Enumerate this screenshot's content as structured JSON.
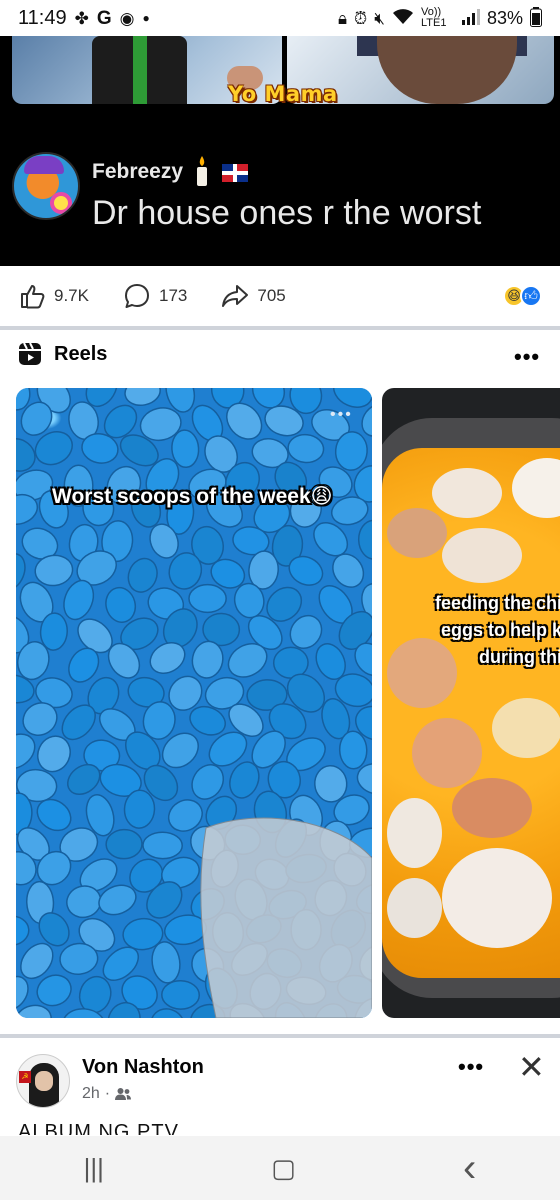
{
  "status_bar": {
    "time": "11:49",
    "left_icons": [
      "pinwheel-icon",
      "google-icon",
      "assistant-icon",
      "dot-icon"
    ],
    "right_icons": [
      "lock-icon",
      "alarm-icon",
      "mute-icon",
      "wifi-icon",
      "signal-icon"
    ],
    "network_label": "Vo)) LTE1",
    "battery": "83%"
  },
  "meme": {
    "title": "Yo Mama",
    "comment": {
      "author": "Febreezy",
      "text": "Dr house ones r the worst"
    }
  },
  "reactions": {
    "likes": "9.7K",
    "comments": "173",
    "shares": "705",
    "emoji_types": [
      "haha",
      "like"
    ]
  },
  "reels": {
    "title": "Reels",
    "more_label": "•••",
    "items": [
      {
        "caption": "Worst scoops of the week😩",
        "menu_label": "•••"
      },
      {
        "caption_lines": [
          "feeding the chic",
          "eggs to help ke",
          "during this"
        ]
      }
    ]
  },
  "next_post": {
    "author": "Von Nashton",
    "time": "2h",
    "audience": "friends-icon",
    "more_label": "•••",
    "close_label": "✕",
    "text": "ALBUM NG PTV"
  },
  "nav": {
    "recent_label": "|||",
    "home_label": "▢",
    "back_label": "‹"
  },
  "colors": {
    "brand_blue": "#1877f2",
    "divider": "#cfd3da",
    "reel_blue": "#1f7fd0"
  }
}
